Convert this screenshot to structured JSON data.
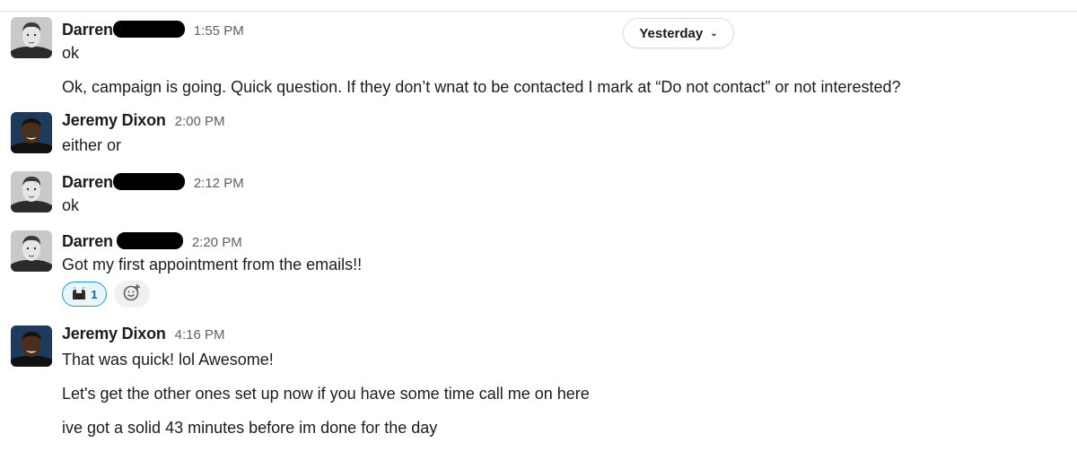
{
  "day_divider": {
    "label": "Yesterday"
  },
  "messages": [
    {
      "author": "Darren",
      "time": "1:55 PM",
      "lines": [
        "ok",
        "Ok, campaign is going.  Quick question.  If they don’t wnat to be contacted I mark at “Do not contact” or not interested?"
      ]
    },
    {
      "author": "Jeremy Dixon",
      "time": "2:00 PM",
      "lines": [
        "either or"
      ]
    },
    {
      "author": "Darren",
      "time": "2:12 PM",
      "lines": [
        "ok"
      ]
    },
    {
      "author": "Darren",
      "time": "2:20 PM",
      "lines": [
        "Got my first appointment from the emails!!"
      ],
      "reactions": [
        {
          "emoji": "raised-hands",
          "count": "1"
        }
      ]
    },
    {
      "author": "Jeremy Dixon",
      "time": "4:16 PM",
      "lines": [
        "That was quick! lol Awesome!",
        "Let's get the other ones set up now if you have some time call me on here",
        "ive got a solid 43 minutes before im done for the day"
      ]
    }
  ],
  "icons": {
    "add_reaction": "add-reaction-icon",
    "chevron": "chevron-down-icon"
  },
  "colors": {
    "reaction_border": "#1d9bd1",
    "reaction_bg": "#e8f5fa",
    "timestamp": "#616061"
  }
}
